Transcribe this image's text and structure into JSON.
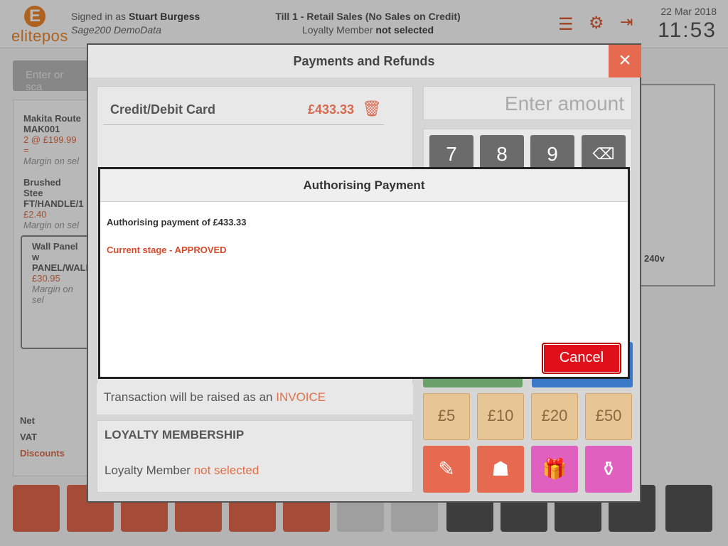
{
  "header": {
    "logo_letter": "E",
    "logo_text": "elitepos",
    "signed_in_prefix": "Signed in as",
    "user": "Stuart Burgess",
    "company": "Sage200 DemoData",
    "till": "Till 1 - Retail Sales (No Sales on Credit)",
    "loyalty_prefix": "Loyalty Member",
    "loyalty_status": "not selected",
    "date": "22 Mar 2018",
    "time": "11:53"
  },
  "background": {
    "search_placeholder": "Enter or sca",
    "items": [
      {
        "name": "Makita Route",
        "code": "MAK001",
        "price": "2 @ £199.99 =",
        "margin": "Margin on sel"
      },
      {
        "name": "Brushed Stee",
        "code": "FT/HANDLE/1",
        "price": "£2.40",
        "margin": "Margin on sel"
      },
      {
        "name": "Wall Panel w",
        "code": "PANEL/WALL",
        "price": "£30.95",
        "margin": "Margin on sel"
      }
    ],
    "totals": [
      "Net",
      "VAT",
      "Discounts"
    ],
    "side_text": "240v"
  },
  "payments": {
    "title": "Payments and Refunds",
    "close": "×",
    "line_label": "Credit/Debit Card",
    "line_amount": "£433.33",
    "amount_placeholder": "Enter amount",
    "keys": [
      "7",
      "8",
      "9",
      "⌫"
    ],
    "invoice_text": "Transaction will be raised as an",
    "invoice_word": "INVOICE",
    "loyalty_title": "LOYALTY MEMBERSHIP",
    "loyalty_label": "Loyalty Member",
    "loyalty_value": "not selected",
    "cash": [
      "£5",
      "£10",
      "£20",
      "£50"
    ]
  },
  "dialog": {
    "title": "Authorising Payment",
    "message": "Authorising payment of £433.33",
    "stage": "Current stage - APPROVED",
    "cancel": "Cancel"
  }
}
